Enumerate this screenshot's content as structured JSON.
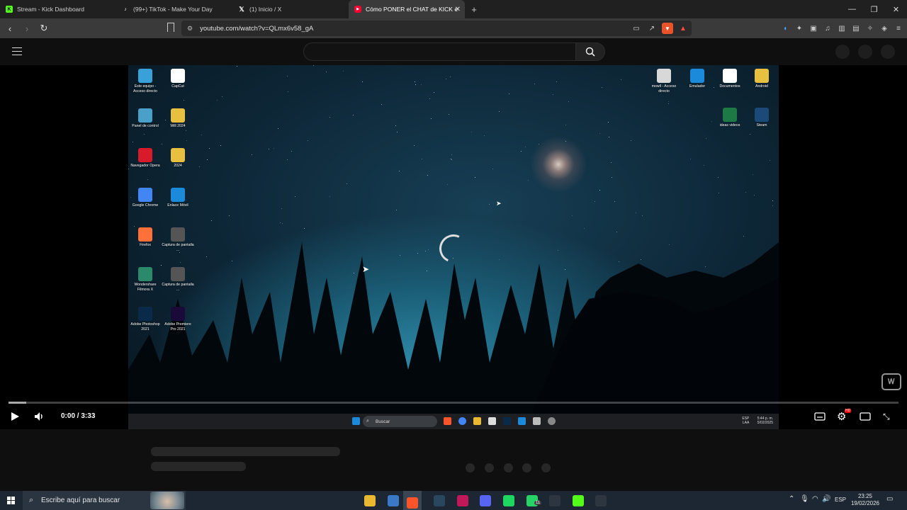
{
  "browser": {
    "tabs": [
      {
        "title": "Stream - Kick Dashboard",
        "icon": "kick-icon",
        "color": "#53fc18"
      },
      {
        "title": "(99+) TikTok - Make Your Day",
        "icon": "tiktok-icon",
        "color": "#ffffff"
      },
      {
        "title": "(1) Inicio / X",
        "icon": "x-icon",
        "color": "#ffffff"
      },
      {
        "title": "Cómo PONER el CHAT de KICK e",
        "icon": "youtube-icon",
        "color": "#ff0033",
        "active": true
      }
    ],
    "url": "youtube.com/watch?v=QLmx6v58_gA"
  },
  "youtube": {
    "search_placeholder": ""
  },
  "video": {
    "time_current": "0:00",
    "time_separator": "/",
    "time_total": "3:33",
    "progress_fraction": 0.02,
    "settings_badge": "HD"
  },
  "desktop_icons_left": [
    {
      "label": "Este equipo - Acceso directo",
      "icon": "monitor-icon",
      "color": "#3aa0d8"
    },
    {
      "label": "CapCut",
      "icon": "capcut-icon",
      "color": "#ffffff"
    },
    {
      "label": "Panel de control",
      "icon": "control-panel-icon",
      "color": "#4aa0c8"
    },
    {
      "label": "Will 2024",
      "icon": "folder-icon",
      "color": "#e8c040"
    },
    {
      "label": "Navegador Opera",
      "icon": "opera-icon",
      "color": "#d81b2a"
    },
    {
      "label": "2024",
      "icon": "folder-icon",
      "color": "#e8c040"
    },
    {
      "label": "Google Chrome",
      "icon": "chrome-icon",
      "color": "#4285f4"
    },
    {
      "label": "Enlace Móvil",
      "icon": "phone-link-icon",
      "color": "#1c8adb"
    },
    {
      "label": "Firefox",
      "icon": "firefox-icon",
      "color": "#ff7139"
    },
    {
      "label": "Captura de pantalla ...",
      "icon": "image-icon",
      "color": "#555555"
    },
    {
      "label": "Wondershare Filmora X",
      "icon": "filmora-icon",
      "color": "#2a8a6a"
    },
    {
      "label": "Captura de pantalla ...",
      "icon": "image-icon",
      "color": "#555555"
    },
    {
      "label": "Adobe Photoshop 2021",
      "icon": "photoshop-icon",
      "color": "#0a2a4a"
    },
    {
      "label": "Adobe Premiere Pro 2021",
      "icon": "premiere-icon",
      "color": "#1a0a3a"
    }
  ],
  "desktop_icons_right": [
    {
      "label": "mowll - Acceso directo",
      "icon": "shortcut-icon",
      "color": "#d8d8d8"
    },
    {
      "label": "Emulador",
      "icon": "emulator-icon",
      "color": "#1c8adb"
    },
    {
      "label": "Documentos",
      "icon": "chrome-icon",
      "color": "#ffffff"
    },
    {
      "label": "Android",
      "icon": "folder-icon",
      "color": "#e8c040"
    },
    {
      "label": "ideas videos",
      "icon": "excel-icon",
      "color": "#1d7a45"
    },
    {
      "label": "Steam",
      "icon": "steam-icon",
      "color": "#1b4a78"
    }
  ],
  "inner_taskbar": {
    "search_label": "Buscar",
    "tray_lang": "ESP",
    "tray_lang2": "LAA",
    "tray_time": "5:44 p. m.",
    "tray_date": "5/02/2025"
  },
  "taskbar": {
    "search_placeholder": "Escribe aquí para buscar",
    "language": "ESP",
    "time": "23:25",
    "date": "19/02/2026",
    "apps": [
      {
        "name": "file-explorer-icon",
        "color": "#e8b830"
      },
      {
        "name": "settings-app-icon",
        "color": "#3a78c8"
      },
      {
        "name": "brave-icon",
        "color": "#fb542b"
      },
      {
        "name": "steam-icon",
        "color": "#2a475e"
      },
      {
        "name": "app-v-icon",
        "color": "#c2185b"
      },
      {
        "name": "discord-icon",
        "color": "#5865f2"
      },
      {
        "name": "spotify-icon",
        "color": "#1ed760"
      },
      {
        "name": "whatsapp-icon",
        "color": "#25d366"
      },
      {
        "name": "clock-app-icon",
        "color": "#2d3640"
      },
      {
        "name": "kick-app-icon",
        "color": "#53fc18"
      },
      {
        "name": "capcut-app-icon",
        "color": "#2d3640"
      }
    ]
  },
  "whatsapp_badge": "11"
}
